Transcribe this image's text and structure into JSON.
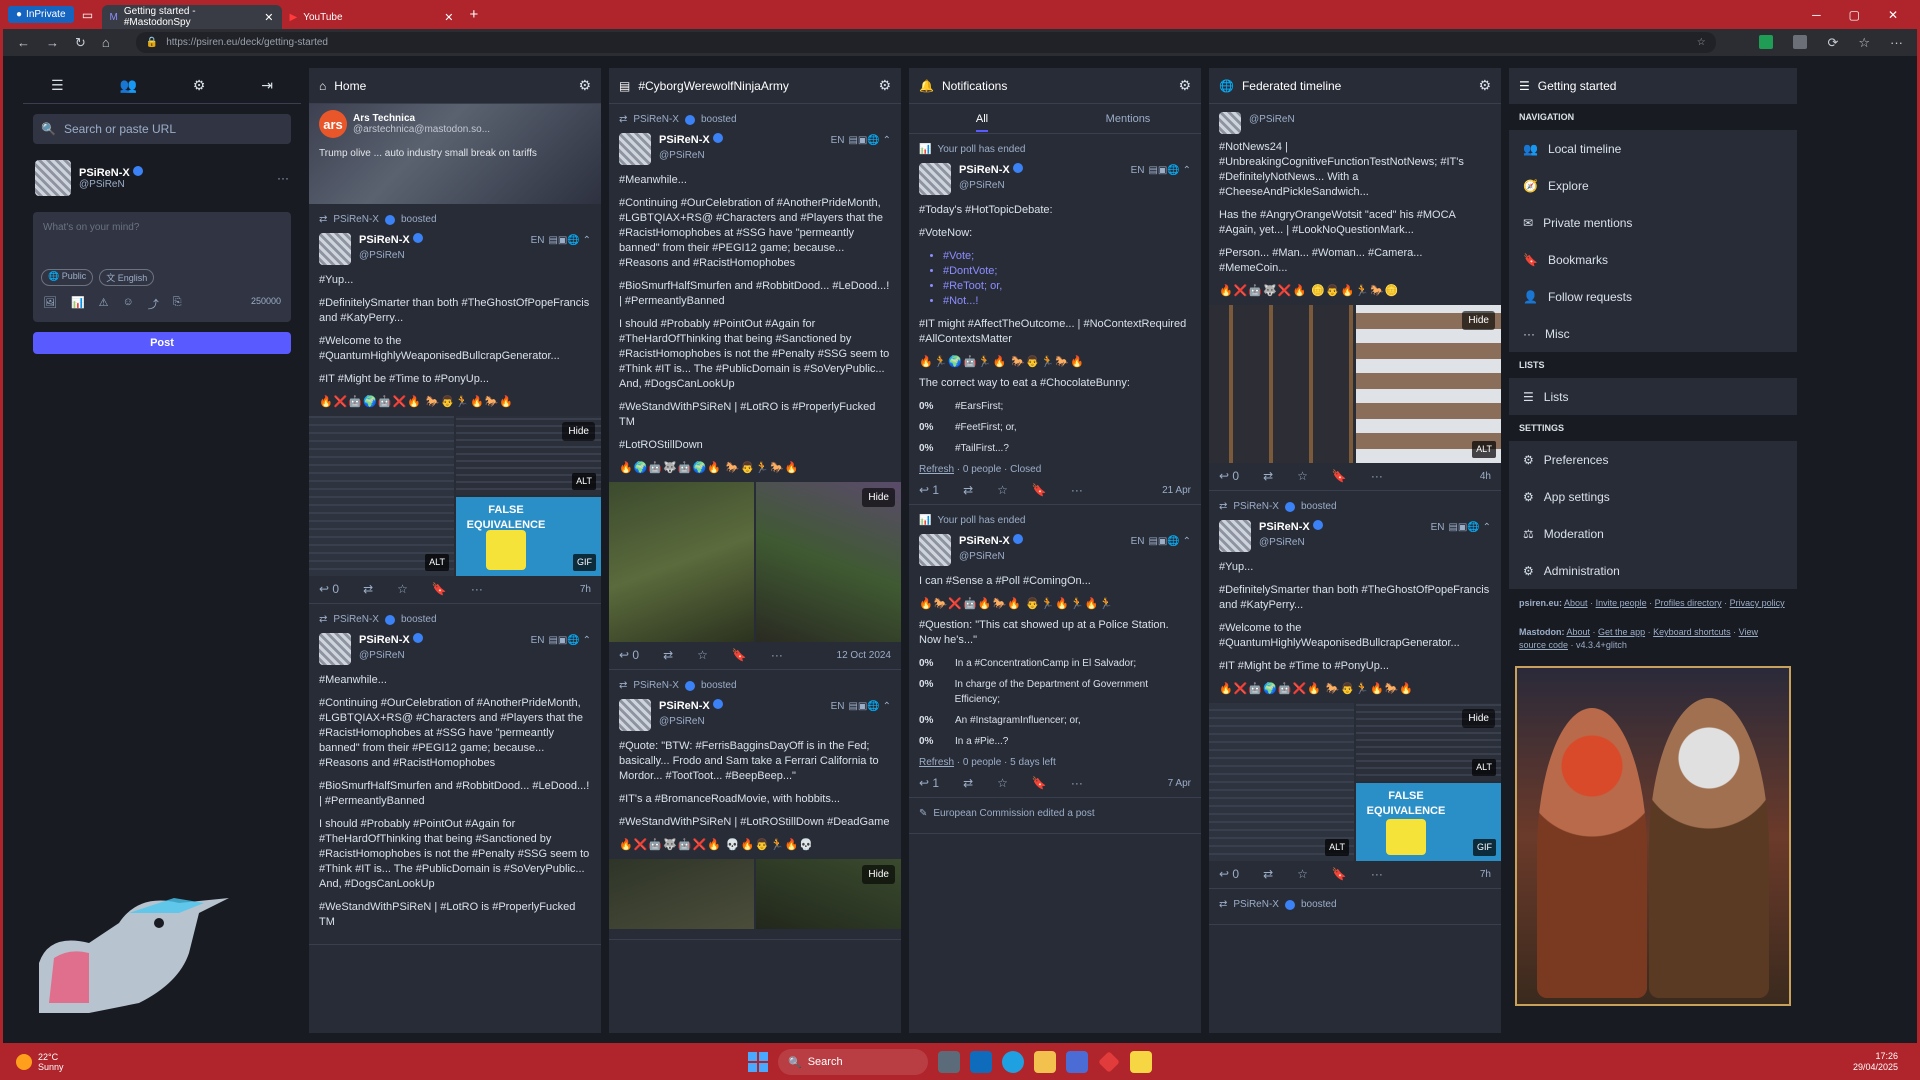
{
  "browser": {
    "inprivate": "InPrivate",
    "tabs": [
      {
        "title": "Getting started - #MastodonSpy"
      },
      {
        "title": "YouTube"
      }
    ],
    "url": "https://psiren.eu/deck/getting-started"
  },
  "compose": {
    "search_placeholder": "Search or paste URL",
    "display_name": "PSiReN-X",
    "handle": "@PSiReN",
    "placeholder": "What's on your mind?",
    "visibility": "Public",
    "language": "English",
    "char_count": "250000",
    "post_label": "Post"
  },
  "home": {
    "title": "Home",
    "card": {
      "source": "Ars Technica",
      "handle": "@arstechnica@mastodon.so...",
      "headline": "Trump olive ... auto industry small break on tariffs"
    },
    "post1": {
      "boosted_by": "PSiReN-X",
      "boosted": "boosted",
      "name": "PSiReN-X",
      "handle": "@PSiReN",
      "lang": "EN",
      "p1": "#Yup...",
      "p2": "#DefinitelySmarter than both #TheGhostOfPopeFrancis and #KatyPerry...",
      "p3": "#Welcome to the #QuantumHighlyWeaponisedBullcrapGenerator...",
      "p4": "#IT #Might be #Time to #PonyUp...",
      "emoji": "🔥❌🤖🌍🤖❌🔥 🐎👨🏃🔥🐎🔥",
      "hide": "Hide",
      "alt": "ALT",
      "gif": "GIF",
      "media_text": "FALSE EQUIVALENCE",
      "replies": "0",
      "time": "7h"
    },
    "post2": {
      "boosted_by": "PSiReN-X",
      "boosted": "boosted",
      "name": "PSiReN-X",
      "handle": "@PSiReN",
      "lang": "EN",
      "p1": "#Meanwhile...",
      "p2": "#Continuing #OurCelebration of #AnotherPrideMonth, #LGBTQIAX+RS@ #Characters and #Players that the #RacistHomophobes at #SSG have \"permeantly banned\" from their #PEGI12 game; because... #Reasons and #RacistHomophobes",
      "p3": "#BioSmurfHalfSmurfen and #RobbitDood... #LeDood...! | #PermeantlyBanned",
      "p4": "I should #Probably #PointOut #Again for #TheHardOfThinking that being #Sanctioned by #RacistHomophobes is not the #Penalty #SSG seem to #Think #IT is... The #PublicDomain is #SoVeryPublic... And, #DogsCanLookUp",
      "p5": "#WeStandWithPSiReN | #LotRO is #ProperlyFucked TM"
    }
  },
  "hashtag": {
    "title": "#CyborgWerewolfNinjaArmy",
    "post1": {
      "boosted_by": "PSiReN-X",
      "boosted": "boosted",
      "name": "PSiReN-X",
      "handle": "@PSiReN",
      "lang": "EN",
      "p1": "#Meanwhile...",
      "p2": "#Continuing #OurCelebration of #AnotherPrideMonth, #LGBTQIAX+RS@ #Characters and #Players that the #RacistHomophobes at #SSG have \"permeantly banned\" from their #PEGI12 game; because... #Reasons and #RacistHomophobes",
      "p3": "#BioSmurfHalfSmurfen and #RobbitDood... #LeDood...! | #PermeantlyBanned",
      "p4": "I should #Probably #PointOut #Again for #TheHardOfThinking that being #Sanctioned by #RacistHomophobes is not the #Penalty #SSG seem to #Think #IT is... The #PublicDomain is #SoVeryPublic... And, #DogsCanLookUp",
      "p5": "#WeStandWithPSiReN | #LotRO is #ProperlyFucked TM",
      "p6": "#LotROStillDown",
      "emoji": "🔥🌍🤖🐺🤖🌍🔥 🐎👨🏃🐎🔥",
      "hide": "Hide",
      "replies": "0",
      "time": "12 Oct 2024"
    },
    "post2": {
      "boosted_by": "PSiReN-X",
      "boosted": "boosted",
      "name": "PSiReN-X",
      "handle": "@PSiReN",
      "lang": "EN",
      "p1": "#Quote: \"BTW: #FerrisBagginsDayOff is in the Fed; basically... Frodo and Sam take a Ferrari California to Mordor... #TootToot... #BeepBeep...\"",
      "p2": "#IT's a #BromanceRoadMovie, with hobbits...",
      "p3": "#WeStandWithPSiReN | #LotROStillDown #DeadGame",
      "emoji": "🔥❌🤖🐺🤖❌🔥 💀🔥👨🏃🔥💀",
      "hide": "Hide"
    }
  },
  "notifications": {
    "title": "Notifications",
    "tab_all": "All",
    "tab_mentions": "Mentions",
    "n1": {
      "label": "Your poll has ended",
      "name": "PSiReN-X",
      "handle": "@PSiReN",
      "lang": "EN",
      "p1": "#Today's #HotTopicDebate:",
      "p2": "#VoteNow:",
      "bullets": [
        "#Vote;",
        "#DontVote;",
        "#ReToot; or,",
        "#Not...!"
      ],
      "p3": "#IT might #AffectTheOutcome... | #NoContextRequired #AllContextsMatter",
      "emoji": "🔥🏃🌍🤖🏃🔥 🐎👨🏃🐎🔥",
      "p4": "The correct way to eat a #ChocolateBunny:",
      "options": [
        {
          "pct": "0%",
          "text": "#EarsFirst;"
        },
        {
          "pct": "0%",
          "text": "#FeetFirst; or,"
        },
        {
          "pct": "0%",
          "text": "#TailFirst...?"
        }
      ],
      "refresh": "Refresh",
      "status": "· 0 people · Closed",
      "replies": "1",
      "time": "21 Apr"
    },
    "n2": {
      "label": "Your poll has ended",
      "name": "PSiReN-X",
      "handle": "@PSiReN",
      "lang": "EN",
      "p1": "I can #Sense a #Poll #ComingOn...",
      "emoji": "🔥🐎❌🤖🔥🐎🔥 👨🏃🔥🏃🔥🏃",
      "p2": "#Question: \"This cat showed up at a Police Station. Now he's...\"",
      "options": [
        {
          "pct": "0%",
          "text": "In a #ConcentrationCamp in El Salvador;"
        },
        {
          "pct": "0%",
          "text": "In charge of the Department of Government Efficiency;"
        },
        {
          "pct": "0%",
          "text": "An #InstagramInfluencer; or,"
        },
        {
          "pct": "0%",
          "text": "In a #Pie...?"
        }
      ],
      "refresh": "Refresh",
      "status": "· 0 people · 5 days left",
      "replies": "1",
      "time": "7 Apr"
    },
    "n3": {
      "label": "European Commission edited a post"
    }
  },
  "federated": {
    "title": "Federated timeline",
    "post1": {
      "handle": "@PSiReN",
      "p1": "#NotNews24 | #UnbreakingCognitiveFunctionTestNotNews; #IT's #DefinitelyNotNews... With a #CheeseAndPickleSandwich...",
      "p2": "Has the #AngryOrangeWotsit \"aced\" his #MOCA #Again, yet... | #LookNoQuestionMark...",
      "p3": "#Person... #Man... #Woman... #Camera... #MemeCoin...",
      "emoji": "🔥❌🤖🐺❌🔥 🪙👨🔥🏃🐎🪙",
      "hide": "Hide",
      "alt": "ALT",
      "replies": "0",
      "time": "4h"
    },
    "post2": {
      "boosted_by": "PSiReN-X",
      "boosted": "boosted",
      "name": "PSiReN-X",
      "handle": "@PSiReN",
      "lang": "EN",
      "p1": "#Yup...",
      "p2": "#DefinitelySmarter than both #TheGhostOfPopeFrancis and #KatyPerry...",
      "p3": "#Welcome to the #QuantumHighlyWeaponisedBullcrapGenerator...",
      "p4": "#IT #Might be #Time to #PonyUp...",
      "emoji": "🔥❌🤖🌍🤖❌🔥 🐎👨🏃🔥🐎🔥",
      "hide": "Hide",
      "alt": "ALT",
      "gif": "GIF",
      "media_text": "FALSE EQUIVALENCE",
      "replies": "0",
      "time": "7h"
    },
    "post3": {
      "boosted_by": "PSiReN-X",
      "boosted": "boosted"
    }
  },
  "getting_started": {
    "title": "Getting started",
    "navigation": "NAVIGATION",
    "nav": [
      "Local timeline",
      "Explore",
      "Private mentions",
      "Bookmarks",
      "Follow requests",
      "Misc"
    ],
    "lists_header": "LISTS",
    "lists": "Lists",
    "settings_header": "SETTINGS",
    "settings": [
      "Preferences",
      "App settings",
      "Moderation",
      "Administration"
    ],
    "footer1": {
      "domain": "psiren.eu:",
      "about": "About",
      "invite": "Invite people",
      "directory": "Profiles directory",
      "privacy": "Privacy policy"
    },
    "footer2": {
      "name": "Mastodon:",
      "about": "About",
      "get_app": "Get the app",
      "shortcuts": "Keyboard shortcuts",
      "source": "View source code",
      "version": "· v4.3.4+glitch"
    }
  },
  "taskbar": {
    "temp": "22°C",
    "weather": "Sunny",
    "search": "Search",
    "time": "17:26",
    "date": "29/04/2025"
  },
  "colors": {
    "accent": "#595aff",
    "frame": "#b0242b",
    "panel": "#282c37",
    "bg": "#191b22",
    "hashtag": "#8c8dff"
  }
}
